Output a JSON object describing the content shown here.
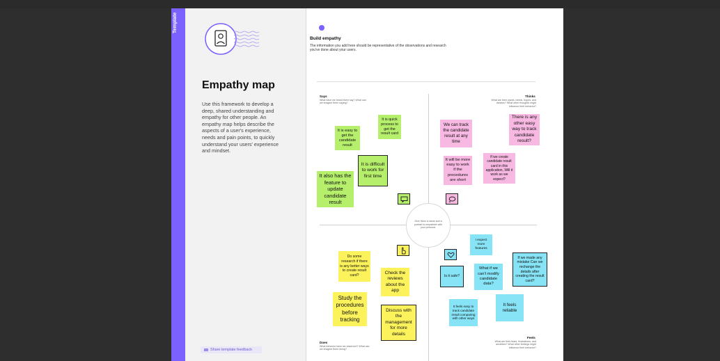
{
  "sidebar": {
    "tag": "Template",
    "title": "Empathy map",
    "description": "Use this framework to develop a deep, shared understanding and empathy for other people. An empathy map helps describe the aspects of a user's experience, needs and pain points, to quickly understand your users' experience and mindset.",
    "feedback_label": "Share template feedback"
  },
  "main": {
    "heading": "Build empathy",
    "description": "The information you add here should be representative of the observations and research you've done about your users.",
    "center_text": "Give them a name and a portrait to empathize with your persona.",
    "quadrants": {
      "says": {
        "label": "Says",
        "desc": "What have we heard them say? What can we imagine them saying?"
      },
      "thinks": {
        "label": "Thinks",
        "desc": "What are their wants, needs, hopes, and dreams? What other thoughts might influence their behavior?"
      },
      "does": {
        "label": "Does",
        "desc": "What behavior have we observed? What can we imagine them doing?"
      },
      "feels": {
        "label": "Feels",
        "desc": "What are their fears, frustrations, and anxieties? What other feelings might influence their behavior?"
      }
    }
  },
  "notes": {
    "says": [
      "It is easy to get the candidate result",
      "It is quick process to get the result card",
      "It is difficult to work for first time",
      "It also has the feature to update candidate result"
    ],
    "thinks": [
      "We can track the candidate result at any time",
      "There is any other easy way to track candidate result?",
      "It will be more easy to work if the procedures are short",
      "If we create candidate result card in this application, Will it work as we expect?"
    ],
    "does": [
      "Do some research if there is any better ways to create result card?",
      "Check the reviews about the app",
      "Study the procedures before tracking",
      "Discuss with the management for more details"
    ],
    "feels": [
      "I expect more features",
      "Is it safe?",
      "What if we can't modify candidate data?",
      "If we made any mistake Can we rechange the details after creating the result card?",
      "It feels easy to track candidate result comparing with other ways",
      "It feels reliable"
    ]
  },
  "colors": {
    "accent": "#7b61ff",
    "green": "#b5ef6b",
    "pink": "#f7b8e2",
    "yellow": "#fcf25c",
    "blue": "#87e4f6"
  },
  "icons": [
    "portrait-icon",
    "speech-bubble-icon",
    "thought-bubble-icon",
    "hand-pointer-icon",
    "heart-icon",
    "feedback-icon"
  ]
}
